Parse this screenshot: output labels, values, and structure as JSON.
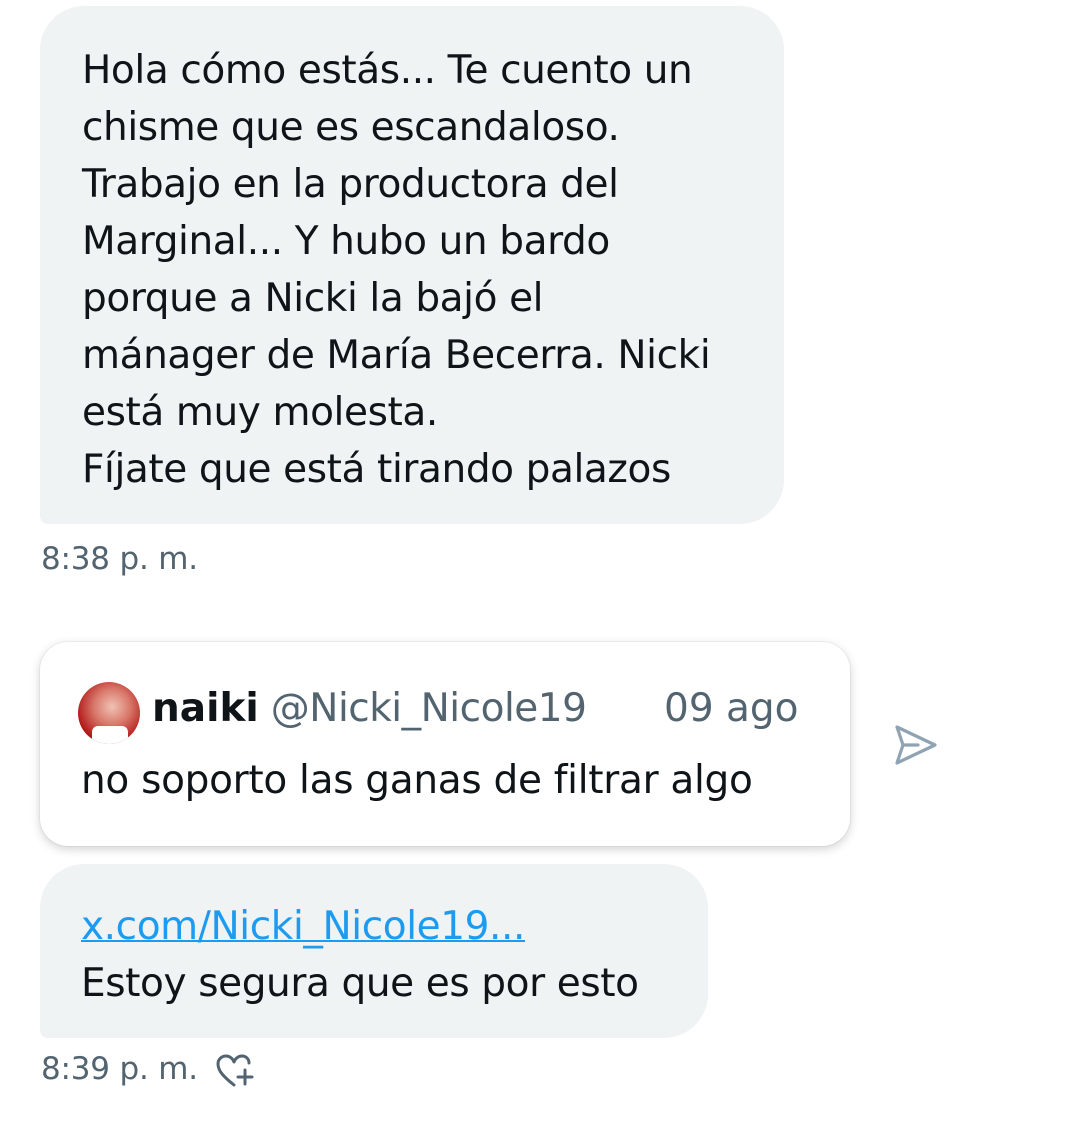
{
  "messages": [
    {
      "text": "Hola cómo estás... Te cuento un\nchisme que es escandaloso.\nTrabajo en la productora del\nMarginal... Y hubo un bardo\nporque a Nicki la bajó el\nmánager de María Becerra. Nicki\nestá muy molesta.\nFíjate que está tirando palazos",
      "time": "8:38 p. m."
    },
    {
      "link": "x.com/Nicki_Nicole19...",
      "text": "Estoy segura que es por esto",
      "time": "8:39 p. m."
    }
  ],
  "quoted_post": {
    "name": "naiki",
    "handle": "@Nicki_Nicole19",
    "date": "09 ago",
    "text": "no soporto las ganas de filtrar algo"
  },
  "icons": {
    "share": "send-icon",
    "react": "heart-add-icon"
  },
  "colors": {
    "bubble": "#eff3f4",
    "text": "#0f1419",
    "secondary": "#536471",
    "link": "#1d9bf0"
  }
}
